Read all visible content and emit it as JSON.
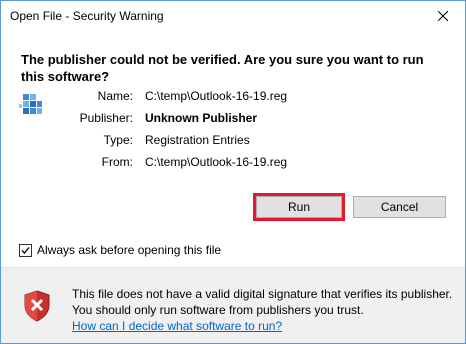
{
  "window": {
    "title": "Open File - Security Warning"
  },
  "warning": {
    "heading": "The publisher could not be verified.  Are you sure you want to run this software?"
  },
  "details": {
    "name_label": "Name:",
    "name_value": "C:\\temp\\Outlook-16-19.reg",
    "publisher_label": "Publisher:",
    "publisher_value": "Unknown Publisher",
    "type_label": "Type:",
    "type_value": "Registration Entries",
    "from_label": "From:",
    "from_value": "C:\\temp\\Outlook-16-19.reg"
  },
  "buttons": {
    "run_label": "Run",
    "cancel_label": "Cancel"
  },
  "checkbox": {
    "label": "Always ask before opening this file",
    "checked": true
  },
  "footer": {
    "message": "This file does not have a valid digital signature that verifies its publisher.  You should only run software from publishers you trust.",
    "link_text": "How can I decide what software to run?"
  },
  "colors": {
    "highlight": "#e01b2a",
    "link": "#0066cc",
    "window_border": "#5b9bd5",
    "shield_red": "#c9302c"
  },
  "icons": {
    "file": "registry-file-icon",
    "shield": "security-shield-error-icon",
    "close": "close-icon"
  }
}
